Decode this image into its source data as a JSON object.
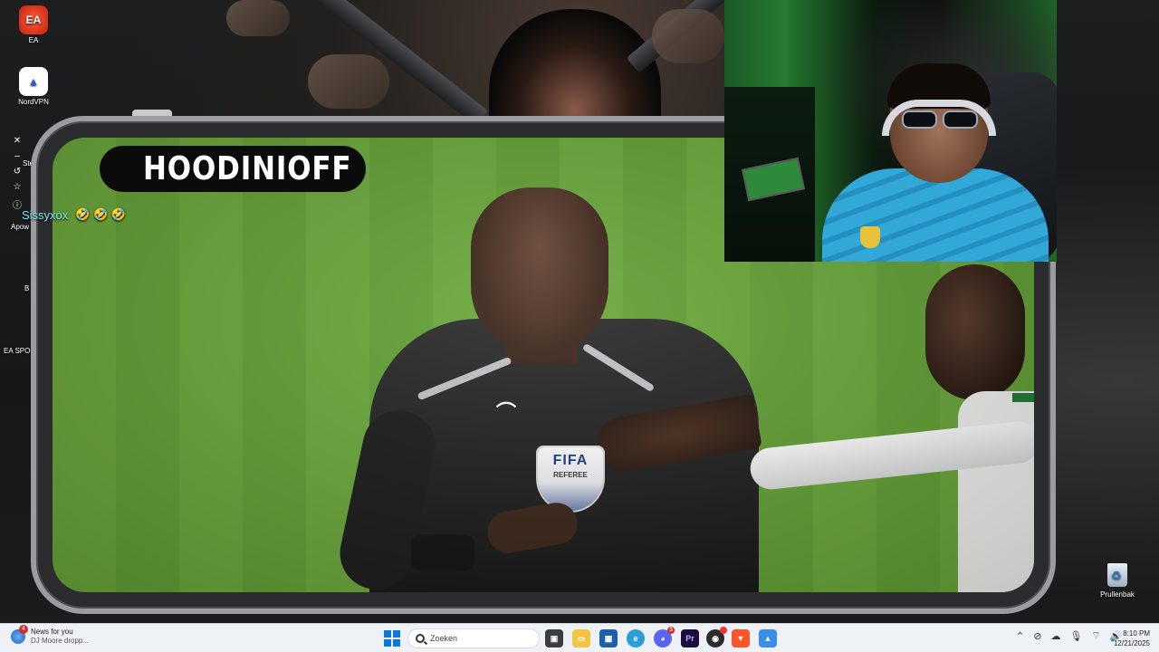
{
  "desktop": {
    "icons": [
      {
        "label": "EA",
        "icon": "ea-app-icon"
      },
      {
        "label": "NordVPN",
        "icon": "nordvpn-icon"
      }
    ],
    "edge_fragments": [
      "Ste",
      "Apow",
      "B",
      "EA SPOR"
    ],
    "recycle_bin_label": "Prullenbak"
  },
  "stream": {
    "channel_name": "HOODINIOFF",
    "platform_icon": "kick-logo-icon",
    "brand_color": "#53fc18",
    "chat_message": {
      "user": "Sissyxox",
      "emojis": "🤣 🤣 🤣"
    }
  },
  "video": {
    "badge_title": "FIFA",
    "badge_subtitle": "REFEREE"
  },
  "taskbar": {
    "news": {
      "title": "News for you",
      "subtitle": "DJ Moore dropp...",
      "badge": "4"
    },
    "search_placeholder": "Zoeken",
    "apps": [
      {
        "name": "task-view-icon"
      },
      {
        "name": "file-explorer-icon"
      },
      {
        "name": "store-icon"
      },
      {
        "name": "edge-icon"
      },
      {
        "name": "discord-icon",
        "badge": "3"
      },
      {
        "name": "premiere-icon",
        "label": "Pr"
      },
      {
        "name": "obs-icon"
      },
      {
        "name": "brave-icon"
      },
      {
        "name": "photos-icon"
      }
    ],
    "clock": {
      "time": "8:10 PM",
      "date": "12/21/2025"
    }
  }
}
